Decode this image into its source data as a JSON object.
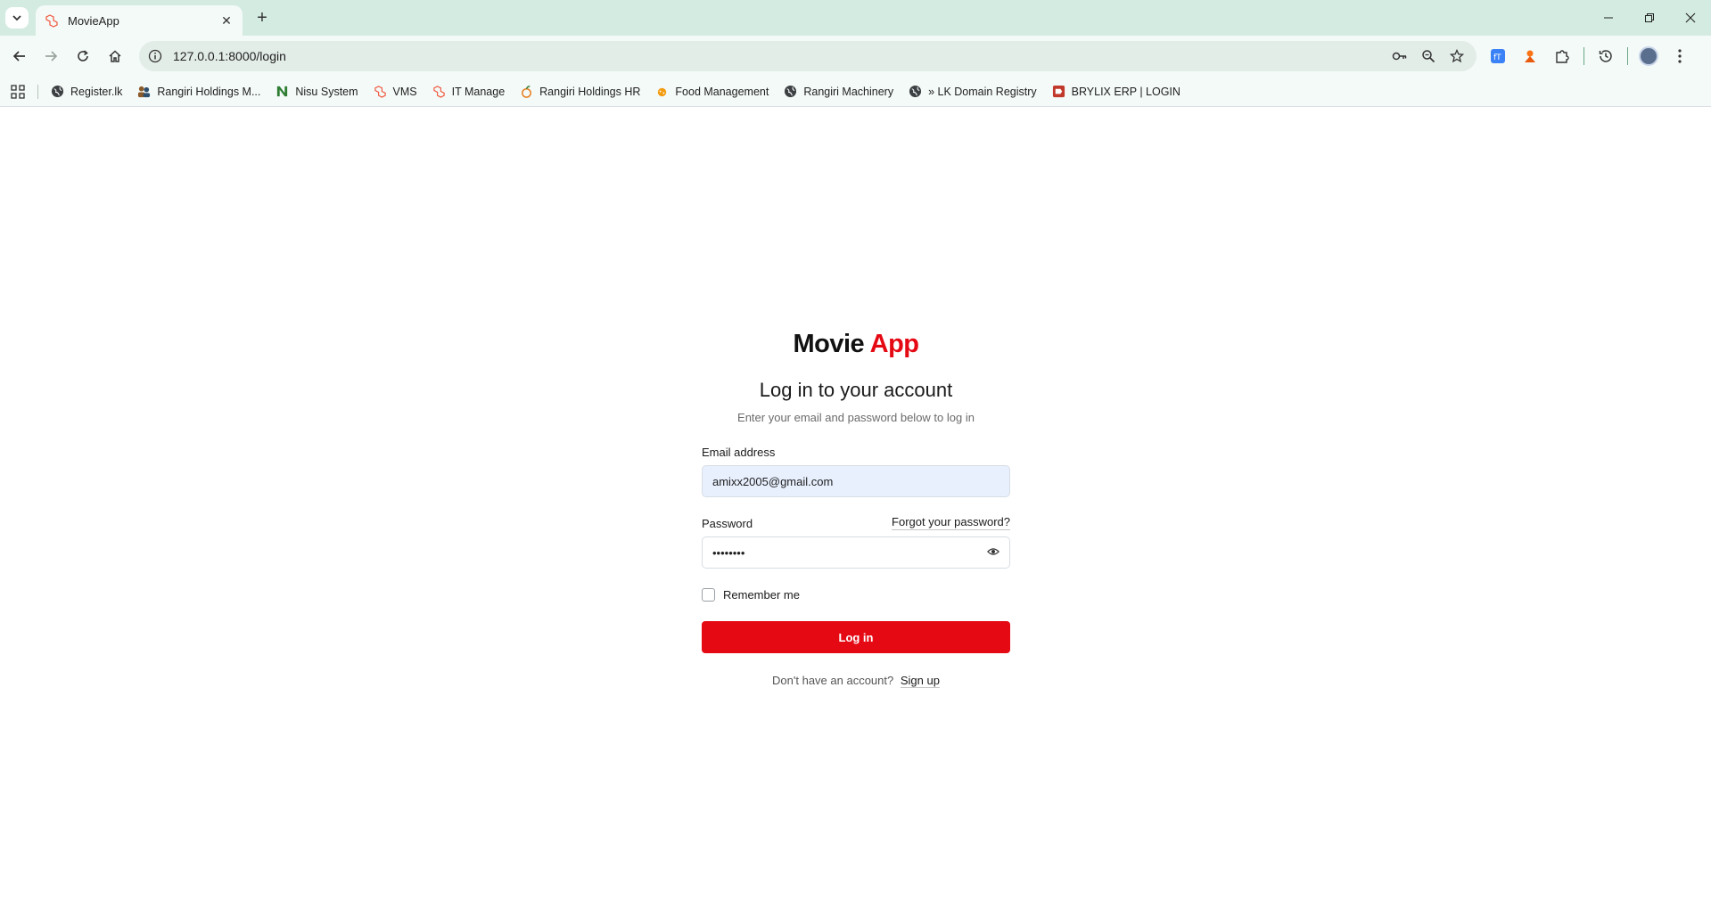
{
  "browser": {
    "tab": {
      "title": "MovieApp",
      "close_icon": "close-icon"
    },
    "new_tab_glyph": "+",
    "url": "127.0.0.1:8000/login",
    "bookmarks": [
      {
        "label": "Register.lk",
        "icon": "globe-icon"
      },
      {
        "label": "Rangiri Holdings M...",
        "icon": "people-icon"
      },
      {
        "label": "Nisu System",
        "icon": "n-logo-icon"
      },
      {
        "label": "VMS",
        "icon": "laravel-icon"
      },
      {
        "label": "IT Manage",
        "icon": "laravel-icon"
      },
      {
        "label": "Rangiri Holdings HR",
        "icon": "fruit-icon"
      },
      {
        "label": "Food Management",
        "icon": "food-icon"
      },
      {
        "label": "Rangiri Machinery",
        "icon": "globe-icon"
      },
      {
        "label": "» LK Domain Registry",
        "icon": "globe-icon"
      },
      {
        "label": "BRYLIX ERP | LOGIN",
        "icon": "brylix-icon"
      }
    ]
  },
  "login": {
    "brand_main": "Movie",
    "brand_accent": "App",
    "heading": "Log in to your account",
    "subheading": "Enter your email and password below to log in",
    "email_label": "Email address",
    "email_value": "amixx2005@gmail.com",
    "password_label": "Password",
    "forgot_link": "Forgot your password?",
    "password_mask": "••••••••",
    "remember_label": "Remember me",
    "login_button": "Log in",
    "signup_prompt": "Don't have an account?",
    "signup_link": "Sign up"
  },
  "colors": {
    "accent": "#e50914",
    "tabstrip": "#d3ebe0",
    "toolbar": "#f4faf7"
  }
}
